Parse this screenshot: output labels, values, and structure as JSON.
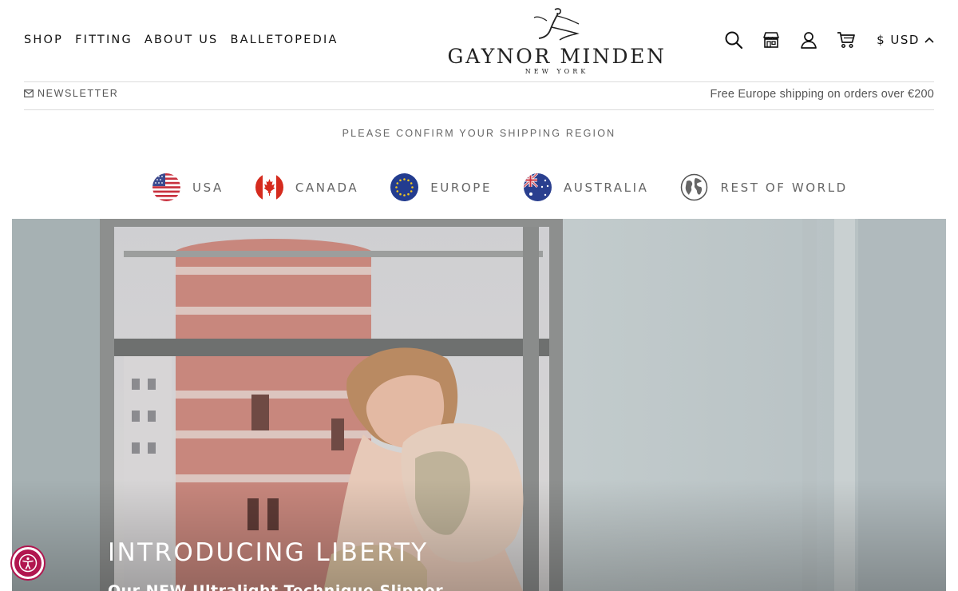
{
  "nav": {
    "items": [
      {
        "label": "SHOP"
      },
      {
        "label": "FITTING"
      },
      {
        "label": "ABOUT US"
      },
      {
        "label": "BALLETOPEDIA"
      }
    ]
  },
  "logo": {
    "brand": "GAYNOR MINDEN",
    "city": "NEW YORK"
  },
  "header_icons": [
    "search-icon",
    "store-icon",
    "account-icon",
    "cart-icon"
  ],
  "currency": {
    "label": "$ USD"
  },
  "newsletter": {
    "label": "NEWSLETTER"
  },
  "shipping_note": "Free Europe shipping on orders over €200",
  "region_selector": {
    "title": "PLEASE CONFIRM YOUR SHIPPING REGION",
    "regions": [
      {
        "label": "USA",
        "icon": "usa-flag-icon"
      },
      {
        "label": "CANADA",
        "icon": "canada-flag-icon"
      },
      {
        "label": "EUROPE",
        "icon": "europe-flag-icon"
      },
      {
        "label": "AUSTRALIA",
        "icon": "australia-flag-icon"
      },
      {
        "label": "REST OF WORLD",
        "icon": "globe-icon"
      }
    ]
  },
  "hero": {
    "title": "INTRODUCING LIBERTY",
    "subtitle": "Our NEW Ultralight Technique Slipper"
  },
  "colors": {
    "accent": "#b1164f",
    "text": "#111111",
    "muted": "#666666"
  }
}
